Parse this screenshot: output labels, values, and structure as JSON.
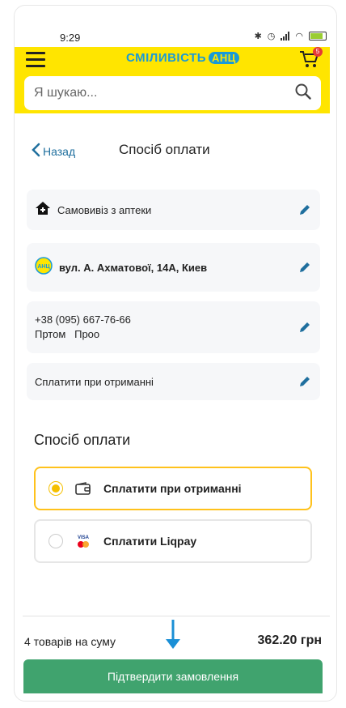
{
  "status_bar": {
    "time": "9:29",
    "battery_label": "100"
  },
  "header": {
    "logo_text": "СМІЛИВІСТЬ",
    "logo_badge": "АНЦ",
    "cart_count": "5",
    "search_placeholder": "Я шукаю..."
  },
  "nav": {
    "back_label": "Назад",
    "page_title": "Спосіб оплати"
  },
  "summary": {
    "delivery": "Самовивіз з аптеки",
    "address": "вул. А. Ахматової, 14А, Киев",
    "phone": "+38 (095) 667-76-66",
    "name": "Пртом   Проо",
    "payment": "Сплатити при отриманні"
  },
  "payment_section": {
    "title": "Спосіб оплати",
    "options": [
      {
        "label": "Сплатити при отриманні",
        "selected": true,
        "icon": "wallet-icon"
      },
      {
        "label": "Сплатити Liqpay",
        "selected": false,
        "icon": "visa-mastercard-icon"
      }
    ]
  },
  "footer": {
    "total_label": "4 товарів на суму",
    "total_value": "362.20 грн",
    "confirm_label": "Підтвердити замовлення"
  },
  "colors": {
    "header_yellow": "#ffe500",
    "accent_blue": "#1a9ad6",
    "confirm_green": "#40a36e",
    "selected_border": "#ffc21c"
  }
}
